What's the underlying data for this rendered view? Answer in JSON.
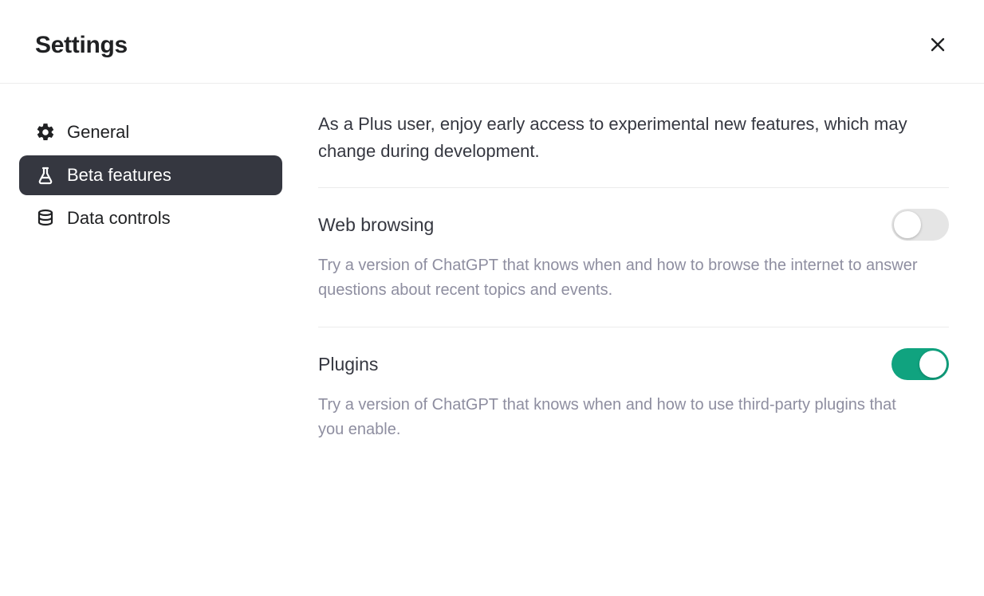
{
  "header": {
    "title": "Settings"
  },
  "sidebar": {
    "items": [
      {
        "label": "General",
        "icon": "gear",
        "active": false
      },
      {
        "label": "Beta features",
        "icon": "flask",
        "active": true
      },
      {
        "label": "Data controls",
        "icon": "database",
        "active": false
      }
    ]
  },
  "content": {
    "intro": "As a Plus user, enjoy early access to experimental new features, which may change during development.",
    "features": [
      {
        "title": "Web browsing",
        "description": "Try a version of ChatGPT that knows when and how to browse the internet to answer questions about recent topics and events.",
        "enabled": false
      },
      {
        "title": "Plugins",
        "description": "Try a version of ChatGPT that knows when and how to use third-party plugins that you enable.",
        "enabled": true
      }
    ]
  }
}
